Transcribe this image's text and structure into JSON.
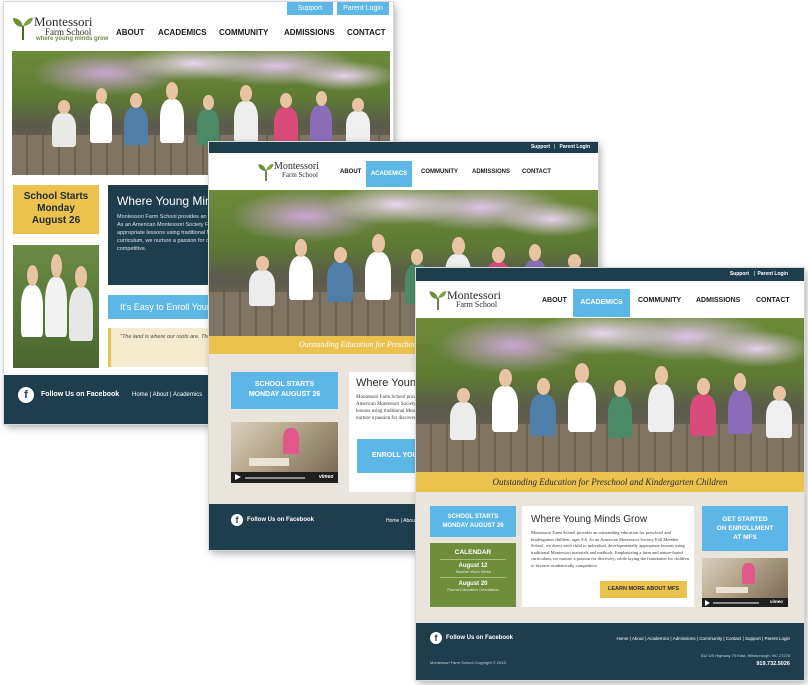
{
  "colors": {
    "navy": "#1e3e4e",
    "blue": "#5db7e6",
    "gold": "#ecc24e",
    "green": "#6f8e3b",
    "cream": "#e9e5dc"
  },
  "brand": {
    "name": "Montessori",
    "sub": "Farm School",
    "tagline": "where young minds grow"
  },
  "util": {
    "support": "Support",
    "parent_login": "Parent Login",
    "sep": "|"
  },
  "nav": [
    "ABOUT",
    "ACADEMICS",
    "COMMUNITY",
    "ADMISSIONS",
    "CONTACT"
  ],
  "panel1": {
    "school_starts": [
      "School Starts",
      "Monday",
      "August 26"
    ],
    "heading": "Where Young Minds Grow",
    "body": "Montessori Farm School provides an outstanding education for preschool and kindergarten children, ages 3-6. As an American Montessori Society Full Member School, we direct each child to individual, developmentally appropriate lessons using traditional Montessori materials and methods. Emphasizing a farm and nature-based curriculum, we nurture a passion for discovery, while laying the foundation for children to become academically competitive.",
    "enroll": "It's Easy to Enroll Your Child",
    "quote": "\"The land is where our roots are. The children must be taught to feel and live in harmony with the earth.\"",
    "follow": "Follow Us on Facebook",
    "footer_links": [
      "Home",
      "About",
      "Academics"
    ]
  },
  "panel2": {
    "banner": "Outstanding Education for Preschool and Kindergarten Children",
    "school_starts": [
      "SCHOOL STARTS",
      "MONDAY AUGUST 26"
    ],
    "heading": "Where Young Minds Grow",
    "body": "Montessori Farm School provides an outstanding education for preschool and kindergarten children, ages 3-6. As an American Montessori Society Full Member School, we direct each child to individual, developmentally appropriate lessons using traditional Montessori materials and methods. Emphasizing a farm and nature-based curriculum, we nurture a passion for discovery, while laying the foundation for children to become academically competitive.",
    "enroll": "ENROLL YOUR CHILD",
    "video_brand": "vimeo",
    "follow": "Follow Us on Facebook",
    "footer_links": [
      "Home",
      "About"
    ]
  },
  "panel3": {
    "banner": "Outstanding Education for Preschool and Kindergarten Children",
    "school_starts": [
      "SCHOOL STARTS",
      "MONDAY AUGUST 26"
    ],
    "calendar": {
      "title": "CALENDAR",
      "date1": "August 12",
      "event1": "Teacher Work Week",
      "date2": "August 20",
      "event2": "Parent Education Orientation"
    },
    "heading": "Where Young Minds Grow",
    "body": "Montessori Farm School provides an outstanding education for preschool and kindergarten children, ages 3-6. As an American Montessori Society Full Member School, we direct each child to individual, developmentally appropriate lessons using traditional Montessori materials and methods. Emphasizing a farm and nature-based curriculum, we nurture a passion for discovery, while laying the foundation for children to become academically competitive.",
    "learn_more": "LEARN MORE ABOUT MFS",
    "enroll": [
      "GET STARTED",
      "ON ENROLLMENT",
      "AT MFS"
    ],
    "video_brand": "vimeo",
    "follow": "Follow Us on Facebook",
    "footer_links": [
      "Home",
      "About",
      "Academics",
      "Admissions",
      "Community",
      "Contact",
      "Support",
      "Parent Login"
    ],
    "copyright": "Montessori Farm School Copyright © 2013",
    "address": "512 US Highway 70 East, Hillsborough, NC 27278",
    "phone": "919.732.5026"
  }
}
